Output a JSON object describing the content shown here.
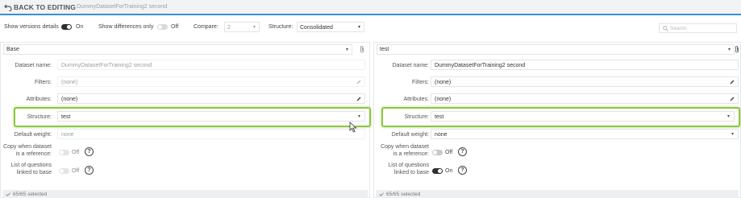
{
  "header": {
    "back_label": "BACK TO EDITING",
    "dataset_title": "DummyDatasetForTraining2 second"
  },
  "toolbar": {
    "show_versions_label": "Show versions details",
    "show_versions_state": "On",
    "show_diff_label": "Show differences only",
    "show_diff_state": "Off",
    "compare_label": "Compare:",
    "compare_value": "2",
    "structure_label": "Structure:",
    "structure_value": "Consolidated",
    "search_placeholder": "Search"
  },
  "left_panel": {
    "version_select": "Base",
    "dataset_name_label": "Dataset name:",
    "dataset_name_value": "DummyDatasetForTraining2 second",
    "filters_label": "Filters:",
    "filters_value": "(none)",
    "attributes_label": "Attributes:",
    "attributes_value": "(none)",
    "structure_label": "Structure:",
    "structure_value": "test",
    "default_weight_label": "Default weight:",
    "default_weight_value": "none",
    "copy_label_1": "Copy when dataset",
    "copy_label_2": "is a reference:",
    "copy_state": "Off",
    "questions_label_1": "List of questions",
    "questions_label_2": "linked to base",
    "questions_state": "Off",
    "selected_text": "65/65 selected"
  },
  "right_panel": {
    "version_select": "test",
    "dataset_name_label": "Dataset name:",
    "dataset_name_value": "DummyDatasetForTraining2 second",
    "filters_label": "Filters:",
    "filters_value": "(none)",
    "attributes_label": "Attributes:",
    "attributes_value": "(none)",
    "structure_label": "Structure:",
    "structure_value": "test",
    "default_weight_label": "Default weight:",
    "default_weight_value": "none",
    "copy_label_1": "Copy when dataset",
    "copy_label_2": "is a reference:",
    "copy_state": "Off",
    "questions_label_1": "List of questions",
    "questions_label_2": "linked to base",
    "questions_state": "On",
    "selected_text": "65/65 selected"
  },
  "colors": {
    "accent_blue": "#3a8fd8",
    "highlight_green": "#8cc63f",
    "toggle_on": "#2f3033",
    "toggle_off": "#d8dadd"
  },
  "help_glyph": "?"
}
